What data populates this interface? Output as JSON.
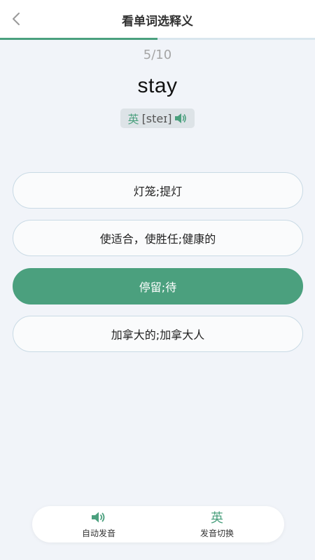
{
  "header": {
    "title": "看单词选释义"
  },
  "progress": {
    "current": 5,
    "total": 10,
    "label": "5/10"
  },
  "word": "stay",
  "phonetic": {
    "lang": "英",
    "text": "[steɪ]"
  },
  "options": [
    {
      "label": "灯笼;提灯",
      "selected": false
    },
    {
      "label": "使适合，使胜任;健康的",
      "selected": false
    },
    {
      "label": "停留;待",
      "selected": true
    },
    {
      "label": "加拿大的;加拿大人",
      "selected": false
    }
  ],
  "bottom_bar": {
    "auto_label": "自动发音",
    "switch_icon": "英",
    "switch_label": "发音切换"
  },
  "colors": {
    "accent": "#4ba07e",
    "background": "#f1f4f9"
  }
}
